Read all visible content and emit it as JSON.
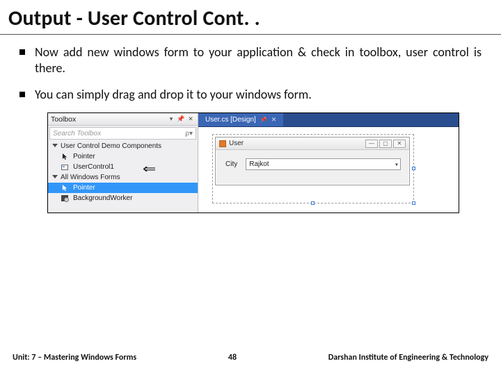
{
  "title": "Output - User Control Cont. .",
  "bullets": [
    "Now add new windows form to your application & check in toolbox, user control is there.",
    "You can simply drag and drop it to your windows form."
  ],
  "toolbox": {
    "title": "Toolbox",
    "search_placeholder": "Search Toolbox",
    "group1": "User Control Demo Components",
    "items1": [
      {
        "label": "Pointer"
      },
      {
        "label": "UserControl1"
      }
    ],
    "group2": "All Windows Forms",
    "items2": [
      {
        "label": "Pointer"
      },
      {
        "label": "BackgroundWorker"
      }
    ]
  },
  "designer": {
    "tab": "User.cs [Design]",
    "form_title": "User",
    "field_label": "City",
    "field_value": "Rajkot"
  },
  "footer": {
    "left": "Unit: 7 – Mastering Windows Forms",
    "page": "48",
    "right": "Darshan Institute of Engineering & Technology"
  }
}
